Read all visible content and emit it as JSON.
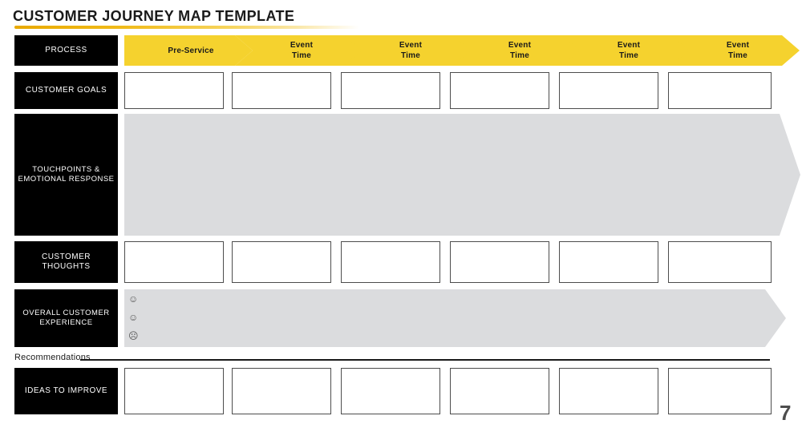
{
  "title": "CUSTOMER JOURNEY MAP TEMPLATE",
  "colors": {
    "yellow": "#F5D22E",
    "gray": "#DBDCDE",
    "black": "#000000",
    "box_border": "#4D4D4D"
  },
  "rows": [
    {
      "key": "process",
      "label": "PROCESS"
    },
    {
      "key": "goals",
      "label": "CUSTOMER GOALS"
    },
    {
      "key": "touchpoints",
      "label": "TOUCHPOINTS &\nEMOTIONAL RESPONSE",
      "label_line1": "TOUCHPOINTS &",
      "label_line2": "EMOTIONAL RESPONSE"
    },
    {
      "key": "thoughts",
      "label": "CUSTOMER THOUGHTS"
    },
    {
      "key": "overall",
      "label": "OVERALL CUSTOMER\nEXPERIENCE",
      "label_line1": "OVERALL CUSTOMER",
      "label_line2": "EXPERIENCE"
    },
    {
      "key": "ideas",
      "label": "IDEAS TO IMPROVE"
    }
  ],
  "stages": [
    {
      "line1": "Pre-Service",
      "line2": ""
    },
    {
      "line1": "Event",
      "line2": "Time"
    },
    {
      "line1": "Event",
      "line2": "Time"
    },
    {
      "line1": "Event",
      "line2": "Time"
    },
    {
      "line1": "Event",
      "line2": "Time"
    },
    {
      "line1": "Event",
      "line2": "Time"
    }
  ],
  "goals_values": [
    "",
    "",
    "",
    "",
    "",
    ""
  ],
  "thoughts_values": [
    "",
    "",
    "",
    "",
    "",
    ""
  ],
  "ideas_values": [
    "",
    "",
    "",
    "",
    "",
    ""
  ],
  "experience_faces": [
    {
      "name": "happy-face-icon",
      "glyph": "☺"
    },
    {
      "name": "neutral-face-icon",
      "glyph": "☺"
    },
    {
      "name": "sad-face-icon",
      "glyph": "☹"
    }
  ],
  "recommendations": {
    "label": "Recommendations"
  },
  "page_number": "7"
}
